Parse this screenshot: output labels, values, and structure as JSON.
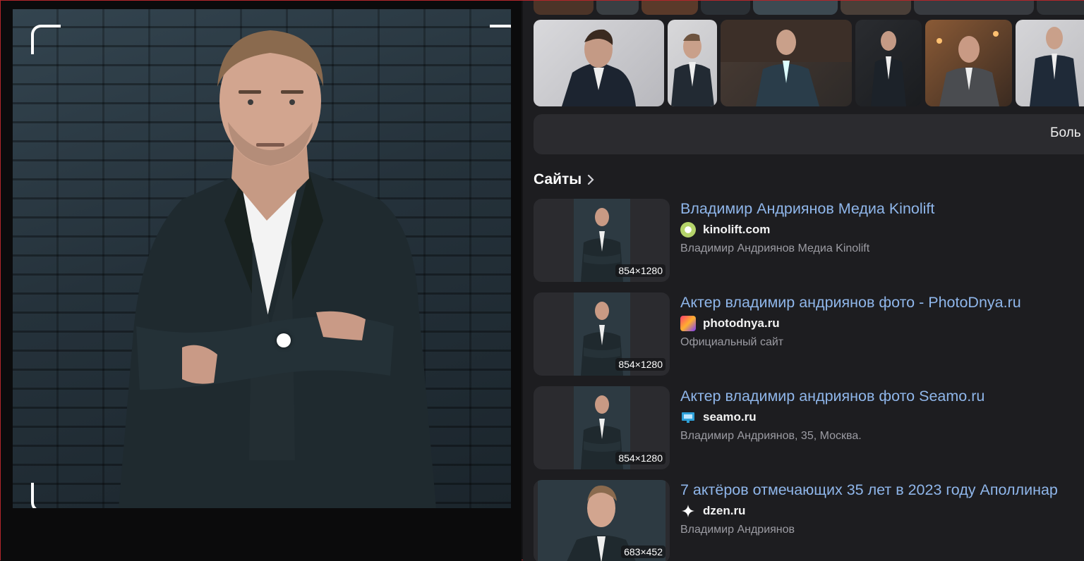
{
  "query_image": {
    "focus_point_label": "",
    "corner_marks": [
      "top-left",
      "top-right",
      "bottom-left",
      "bottom-right"
    ]
  },
  "similar_images": {
    "more_button_label": "Боль"
  },
  "sites": {
    "heading": "Сайты",
    "items": [
      {
        "title": "Владимир Андриянов Медиа Kinolift",
        "domain": "kinolift.com",
        "snippet": "Владимир Андриянов Медиа Kinolift",
        "size": "854×1280",
        "favicon_color": "#b5d46a"
      },
      {
        "title": "Актер владимир андриянов фото - PhotoDnya.ru",
        "domain": "photodnya.ru",
        "snippet": "Официальный сайт",
        "size": "854×1280",
        "favicon_color": "#ff7a2a"
      },
      {
        "title": "Актер владимир андриянов фото Seamo.ru",
        "domain": "seamo.ru",
        "snippet": "Владимир Андриянов, 35, Москва.",
        "size": "854×1280",
        "favicon_color": "#2ea0d8"
      },
      {
        "title": "7 актёров отмечающих 35 лет в 2023 году Аполлинар",
        "domain": "dzen.ru",
        "snippet": "Владимир Андриянов",
        "size": "683×452",
        "favicon_color": "#ffffff"
      }
    ]
  },
  "colors": {
    "link": "#8fb6ea",
    "background": "#1d1d20",
    "card": "#2b2b2f"
  }
}
